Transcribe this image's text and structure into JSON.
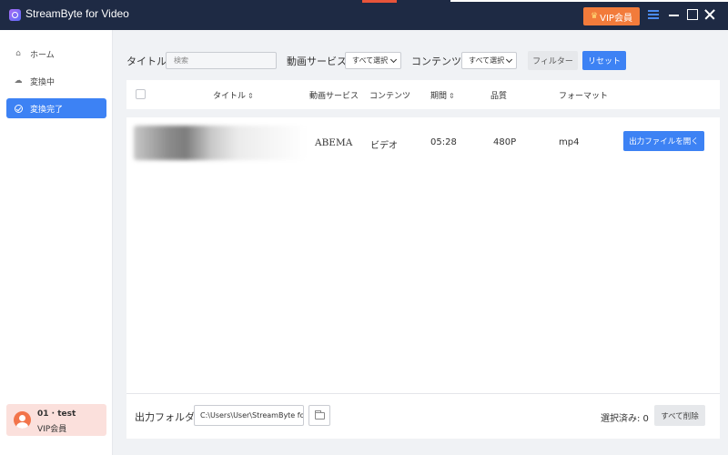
{
  "app": {
    "title": "StreamByte for Video",
    "vip_button_label": "VIP会員",
    "icons": [
      "app-logo-icon",
      "crown-icon",
      "menu-icon",
      "minimize-icon",
      "maximize-icon",
      "close-icon"
    ],
    "accent_color": "#3d82f4",
    "vip_color": "#f27b3b",
    "titlebar_color": "#1e2a44"
  },
  "sidebar": {
    "items": [
      {
        "label": "ホーム",
        "icon": "home-icon",
        "active": false
      },
      {
        "label": "変換中",
        "icon": "cloud-download-icon",
        "active": false
      },
      {
        "label": "変換完了",
        "icon": "check-circle-icon",
        "active": true
      }
    ],
    "user": {
      "name": "01 · test",
      "tier": "VIP会員"
    }
  },
  "filters": {
    "title_label": "タイトル",
    "search_placeholder": "検索",
    "service_label": "動画サービス",
    "service_value": "すべて選択",
    "content_label": "コンテンツ",
    "content_value": "すべて選択",
    "filter_button": "フィルター",
    "reset_button": "リセット"
  },
  "table": {
    "headers": {
      "title": "タイトル",
      "service": "動画サービス",
      "content": "コンテンツ",
      "duration": "期間",
      "quality": "品質",
      "format": "フォーマット"
    },
    "rows": [
      {
        "title": "",
        "service": "ABEMA",
        "content": "ビデオ",
        "duration": "05:28",
        "quality": "480P",
        "format": "mp4",
        "action": "出力ファイルを開く"
      }
    ]
  },
  "footer": {
    "output_folder_label": "出力フォルダ",
    "output_path": "C:\\Users\\User\\StreamByte fo",
    "selected_label": "選択済み: 0",
    "delete_all_button": "すべて削除"
  }
}
